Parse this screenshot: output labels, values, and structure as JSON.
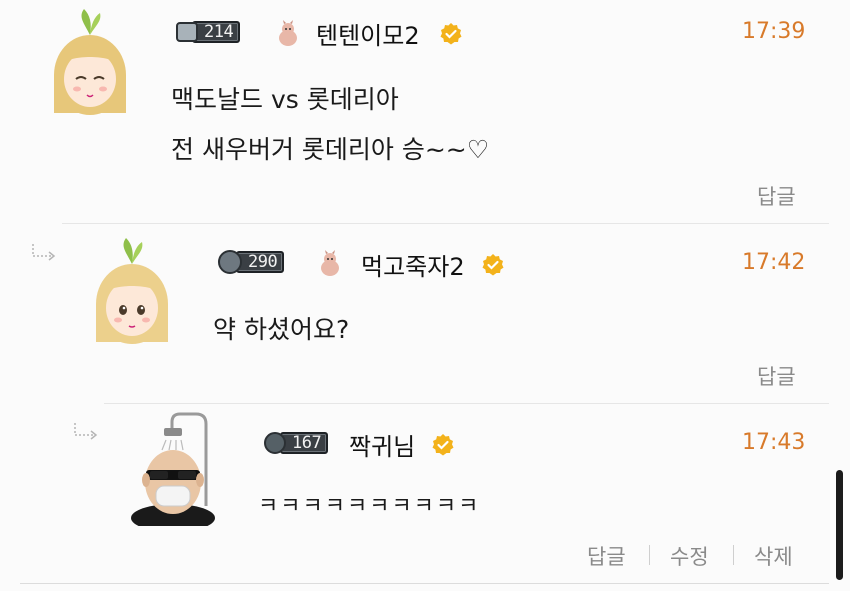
{
  "comments": [
    {
      "level": "214",
      "nickname": "텐텐이모2",
      "time": "17:39",
      "lines": [
        "맥도날드 vs 롯데리아",
        "전 새우버거 롯데리아 승~~♡"
      ],
      "actions": [
        "답글"
      ]
    },
    {
      "level": "290",
      "nickname": "먹고죽자2",
      "time": "17:42",
      "lines": [
        "약 하셨어요?"
      ],
      "actions": [
        "답글"
      ]
    },
    {
      "level": "167",
      "nickname": "짝귀님",
      "time": "17:43",
      "lines": [
        "ㅋㅋㅋㅋㅋㅋㅋㅋㅋㅋ"
      ],
      "actions": [
        "답글",
        "수정",
        "삭제"
      ]
    }
  ],
  "colors": {
    "time": "#d87a2a",
    "badge": "#f3b21b",
    "action": "#8a8a8a"
  },
  "icons": [
    "reply-arrow-icon",
    "verified-badge-icon",
    "level-badge-icon",
    "pet-icon"
  ]
}
